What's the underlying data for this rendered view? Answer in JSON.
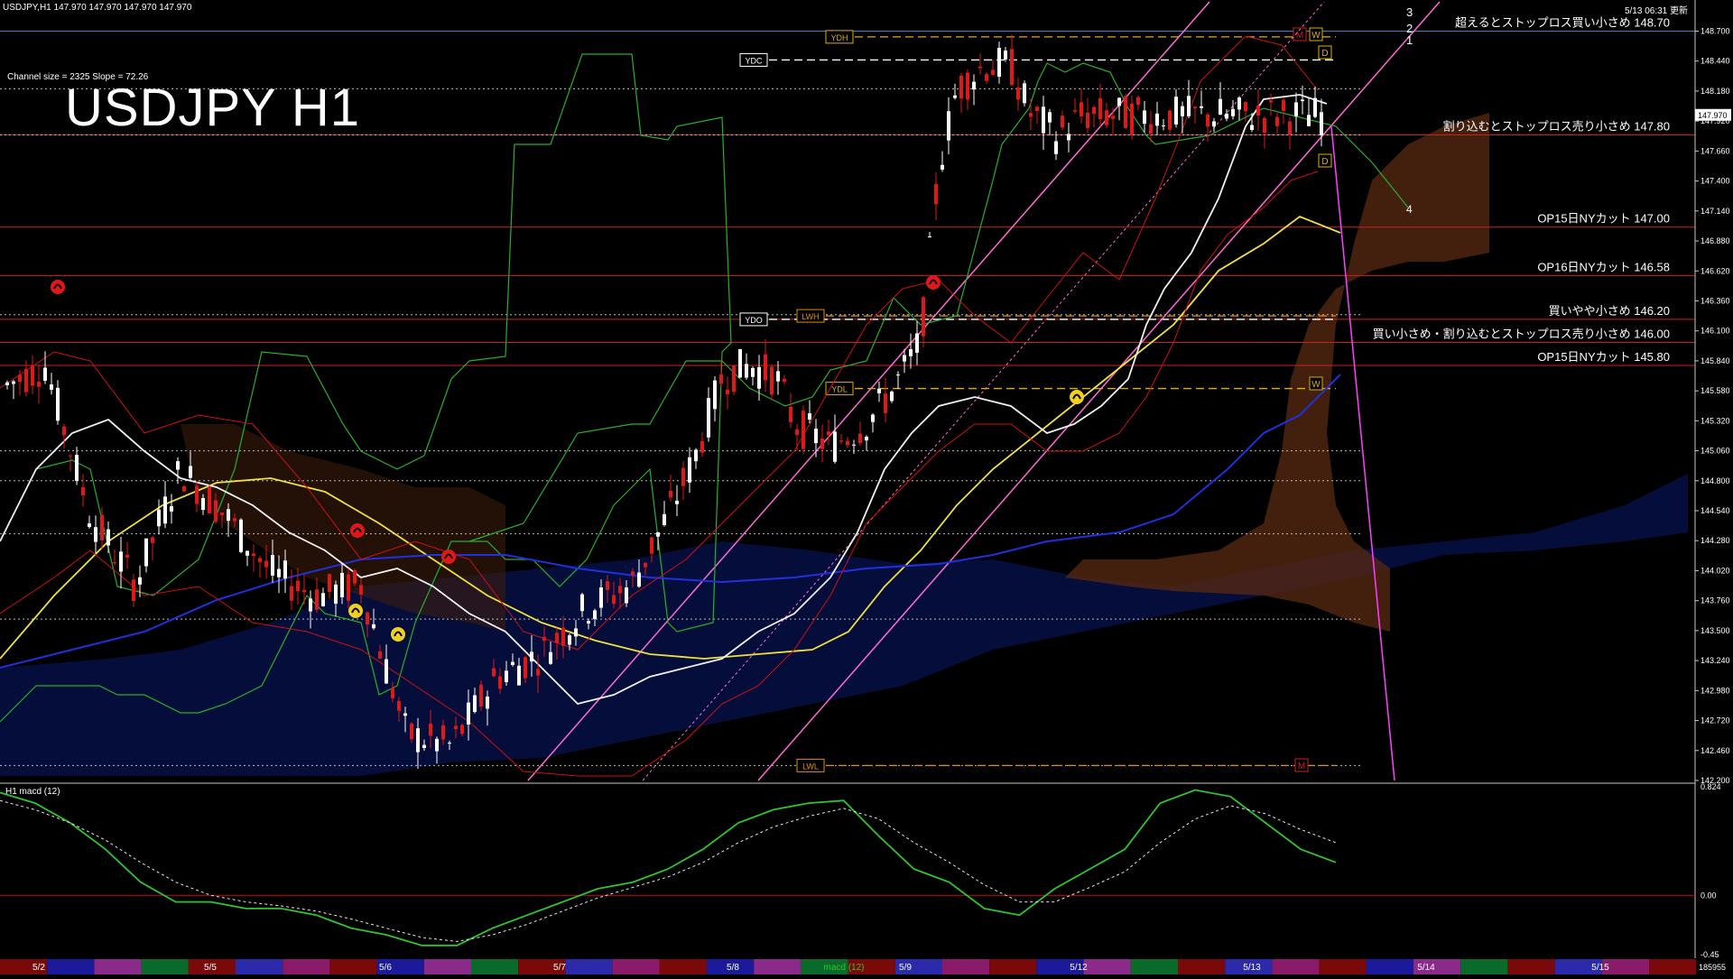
{
  "header": {
    "symbol_info": "USDJPY,H1  147.970 147.970 147.970 147.970",
    "big_title": "USDJPY H1",
    "channel_info": "Channel size = 2325 Slope = 72.26",
    "update_time": "5/13 06:31 更新"
  },
  "channel_labels": [
    "3",
    "2",
    "1"
  ],
  "wave_label": "4",
  "chart_data": [
    {
      "type": "candlestick",
      "title": "USDJPY H1",
      "ylim": [
        142.2,
        148.97
      ],
      "y_ticks": [
        "148.700",
        "148.440",
        "148.180",
        "147.920",
        "147.660",
        "147.400",
        "147.140",
        "146.880",
        "146.620",
        "146.360",
        "146.100",
        "145.840",
        "145.580",
        "145.320",
        "145.060",
        "144.800",
        "144.540",
        "144.280",
        "144.020",
        "143.760",
        "143.500",
        "143.240",
        "142.980",
        "142.720",
        "142.460",
        "142.200"
      ],
      "current_price": "147.970",
      "x_labels": [
        "5/2",
        "5/5",
        "5/6",
        "5/7",
        "5/8",
        "5/9",
        "5/12",
        "5/13",
        "5/14",
        "5/15"
      ],
      "price_series_approx": [
        [
          0,
          145.6
        ],
        [
          50,
          145.8
        ],
        [
          100,
          144.5
        ],
        [
          150,
          143.9
        ],
        [
          200,
          144.9
        ],
        [
          250,
          144.5
        ],
        [
          300,
          144.0
        ],
        [
          350,
          143.8
        ],
        [
          400,
          143.9
        ],
        [
          450,
          142.6
        ],
        [
          500,
          142.5
        ],
        [
          550,
          143.1
        ],
        [
          600,
          143.3
        ],
        [
          650,
          143.7
        ],
        [
          700,
          143.9
        ],
        [
          740,
          144.5
        ],
        [
          770,
          145.0
        ],
        [
          800,
          145.7
        ],
        [
          830,
          145.8
        ],
        [
          860,
          145.7
        ],
        [
          880,
          145.3
        ],
        [
          920,
          145.1
        ],
        [
          960,
          145.3
        ],
        [
          990,
          145.6
        ],
        [
          1020,
          146.0
        ],
        [
          1040,
          147.5
        ],
        [
          1060,
          148.2
        ],
        [
          1090,
          148.4
        ],
        [
          1120,
          148.4
        ],
        [
          1140,
          148.0
        ],
        [
          1170,
          147.8
        ],
        [
          1200,
          147.97
        ]
      ],
      "horizontal_levels": [
        {
          "label": "超えるとストップロス買い小さめ 148.70",
          "value": 148.7,
          "color": "#4a7cc8"
        },
        {
          "label": "割り込むとストップロス売り小さめ 147.80",
          "value": 147.8,
          "color": "#d02020"
        },
        {
          "label": "OP15日NYカット 147.00",
          "value": 147.0,
          "color": "#d02020"
        },
        {
          "label": "OP16日NYカット 146.58",
          "value": 146.58,
          "color": "#d02020"
        },
        {
          "label": "買いやや小さめ 146.20",
          "value": 146.2,
          "color": "#d02020"
        },
        {
          "label": "買い小さめ・割り込むとストップロス売り小さめ 146.00",
          "value": 146.0,
          "color": "#d02020"
        },
        {
          "label": "OP15日NYカット 145.80",
          "value": 145.8,
          "color": "#d02020"
        }
      ],
      "tags": [
        {
          "label": "YDH",
          "value": 148.65
        },
        {
          "label": "YDC",
          "value": 148.45
        },
        {
          "label": "YDO",
          "value": 146.2
        },
        {
          "label": "LWH",
          "value": 146.23
        },
        {
          "label": "YDL",
          "value": 145.6
        },
        {
          "label": "LWL",
          "value": 142.33
        }
      ],
      "marker_letters": [
        "M",
        "W",
        "D",
        "D",
        "W",
        "M"
      ]
    },
    {
      "type": "line",
      "title": "H1  macd (12)",
      "ylim": [
        -0.45,
        0.824
      ],
      "y_ticks": [
        "0.824",
        "0.00",
        "-0.45"
      ],
      "series": [
        {
          "name": "",
          "color": "#2ec52e",
          "values": [
            0.78,
            0.7,
            0.55,
            0.35,
            0.1,
            -0.05,
            -0.05,
            -0.1,
            -0.1,
            -0.15,
            -0.25,
            -0.3,
            -0.38,
            -0.38,
            -0.25,
            -0.15,
            -0.05,
            0.05,
            0.1,
            0.2,
            0.35,
            0.55,
            0.65,
            0.7,
            0.72,
            0.45,
            0.2,
            0.1,
            -0.1,
            -0.15,
            0.05,
            0.2,
            0.35,
            0.7,
            0.8,
            0.75,
            0.55,
            0.35,
            0.25
          ]
        },
        {
          "name": "",
          "color": "#e8e8e8",
          "values": [
            0.72,
            0.65,
            0.55,
            0.42,
            0.25,
            0.1,
            0.0,
            -0.05,
            -0.08,
            -0.12,
            -0.18,
            -0.25,
            -0.32,
            -0.35,
            -0.3,
            -0.22,
            -0.12,
            -0.02,
            0.06,
            0.14,
            0.25,
            0.4,
            0.52,
            0.6,
            0.66,
            0.58,
            0.4,
            0.25,
            0.08,
            -0.05,
            -0.05,
            0.06,
            0.18,
            0.4,
            0.58,
            0.68,
            0.62,
            0.5,
            0.4
          ]
        }
      ]
    }
  ],
  "time_bar_label": "macd (12)",
  "bottom_right": "185955"
}
